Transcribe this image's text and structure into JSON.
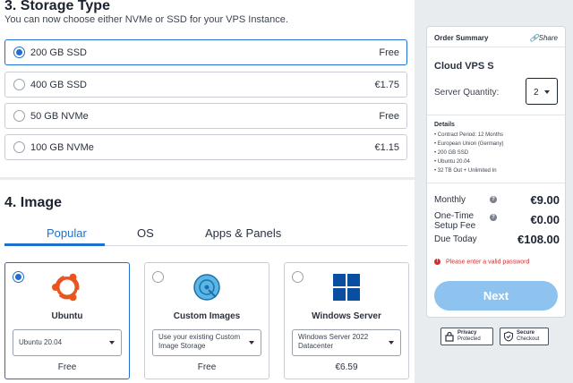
{
  "storage": {
    "title": "3. Storage Type",
    "subtitle": "You can now choose either NVMe or SSD for your VPS Instance.",
    "options": [
      {
        "label": "200 GB SSD",
        "price": "Free",
        "selected": true
      },
      {
        "label": "400 GB SSD",
        "price": "€1.75",
        "selected": false
      },
      {
        "label": "50 GB NVMe",
        "price": "Free",
        "selected": false
      },
      {
        "label": "100 GB NVMe",
        "price": "€1.15",
        "selected": false
      }
    ]
  },
  "image": {
    "title": "4. Image",
    "tabs": [
      "Popular",
      "OS",
      "Apps & Panels"
    ],
    "active_tab": "Popular",
    "cards": [
      {
        "name": "Ubuntu",
        "select": "Ubuntu 20.04",
        "price": "Free",
        "selected": true,
        "icon": "ubuntu-icon"
      },
      {
        "name": "Custom Images",
        "select": "Use your existing Custom Image Storage",
        "price": "Free",
        "selected": false,
        "icon": "custom-image-icon"
      },
      {
        "name": "Windows Server",
        "select": "Windows Server 2022 Datacenter",
        "price": "€6.59",
        "selected": false,
        "icon": "windows-icon"
      }
    ]
  },
  "summary": {
    "heading": "Order Summary",
    "share": "Share",
    "product": "Cloud VPS S",
    "quantity_label": "Server Quantity:",
    "quantity": "2",
    "details_heading": "Details",
    "details": [
      "Contract Period: 12 Months",
      "European Union (Germany)",
      "200 GB SSD",
      "Ubuntu 20.04",
      "32 TB Out + Unlimited In"
    ],
    "monthly_label": "Monthly",
    "monthly_value": "€9.00",
    "setup_label": "One-Time Setup Fee",
    "setup_value": "€0.00",
    "due_label": "Due Today",
    "due_value": "€108.00",
    "error": "Please enter a valid password",
    "next": "Next"
  },
  "badges": {
    "privacy_strong": "Privacy",
    "privacy_sub": "Protected",
    "secure_strong": "Secure",
    "secure_sub": "Checkout"
  },
  "colors": {
    "accent": "#1f6fce",
    "next_button": "#8ec3ef",
    "error": "#d72b2b",
    "ubuntu": "#e95420",
    "windows": "#0a4ea2"
  }
}
